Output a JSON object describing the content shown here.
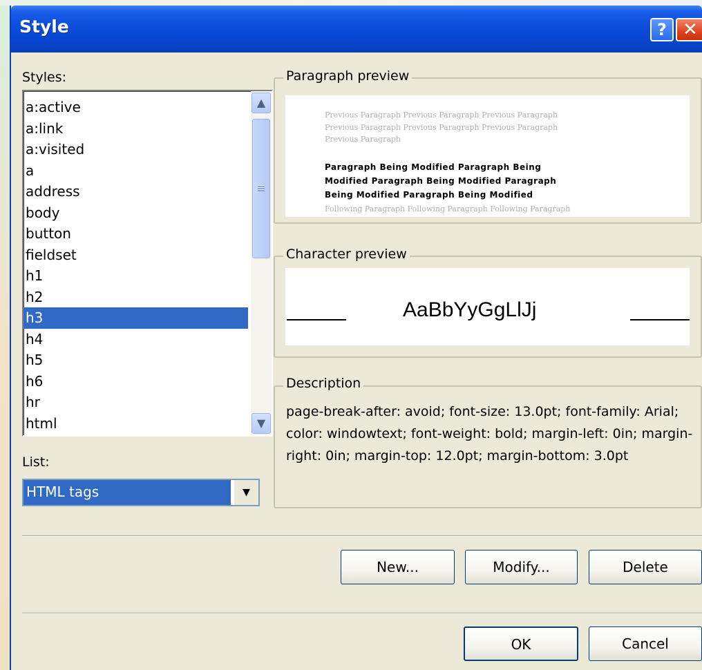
{
  "window": {
    "title": "Style",
    "help_glyph": "?",
    "close_glyph": "✕"
  },
  "styles_panel": {
    "label": "Styles:",
    "items": [
      "a:active",
      "a:link",
      "a:visited",
      "a",
      "address",
      "body",
      "button",
      "fieldset",
      "h1",
      "h2",
      "h3",
      "h4",
      "h5",
      "h6",
      "hr",
      "html"
    ],
    "selected": "h3",
    "scroll_up_glyph": "▲",
    "scroll_down_glyph": "▼"
  },
  "list_panel": {
    "label": "List:",
    "value": "HTML tags",
    "dropdown_glyph": "▼"
  },
  "paragraph_preview": {
    "title": "Paragraph preview",
    "previous_lines": [
      "Previous Paragraph Previous Paragraph Previous Paragraph",
      "Previous Paragraph Previous Paragraph Previous Paragraph",
      "Previous Paragraph"
    ],
    "modified_lines": [
      "Paragraph Being Modified Paragraph Being",
      "Modified Paragraph Being Modified Paragraph",
      "Being Modified Paragraph Being Modified"
    ],
    "following_line": "Following Paragraph Following Paragraph Following Paragraph"
  },
  "character_preview": {
    "title": "Character preview",
    "sample": "AaBbYyGgLlJj"
  },
  "description": {
    "title": "Description",
    "text": "page-break-after: avoid; font-size: 13.0pt; font-family: Arial; color: windowtext; font-weight: bold; margin-left: 0in; margin-right: 0in; margin-top: 12.0pt; margin-bottom: 3.0pt"
  },
  "buttons": {
    "new": "New...",
    "modify": "Modify...",
    "delete": "Delete",
    "ok": "OK",
    "cancel": "Cancel"
  },
  "colors": {
    "titlebar": "#0a4fdc",
    "selection": "#316ac5",
    "dialog_bg": "#ece9d8",
    "close_button": "#e0441f"
  }
}
